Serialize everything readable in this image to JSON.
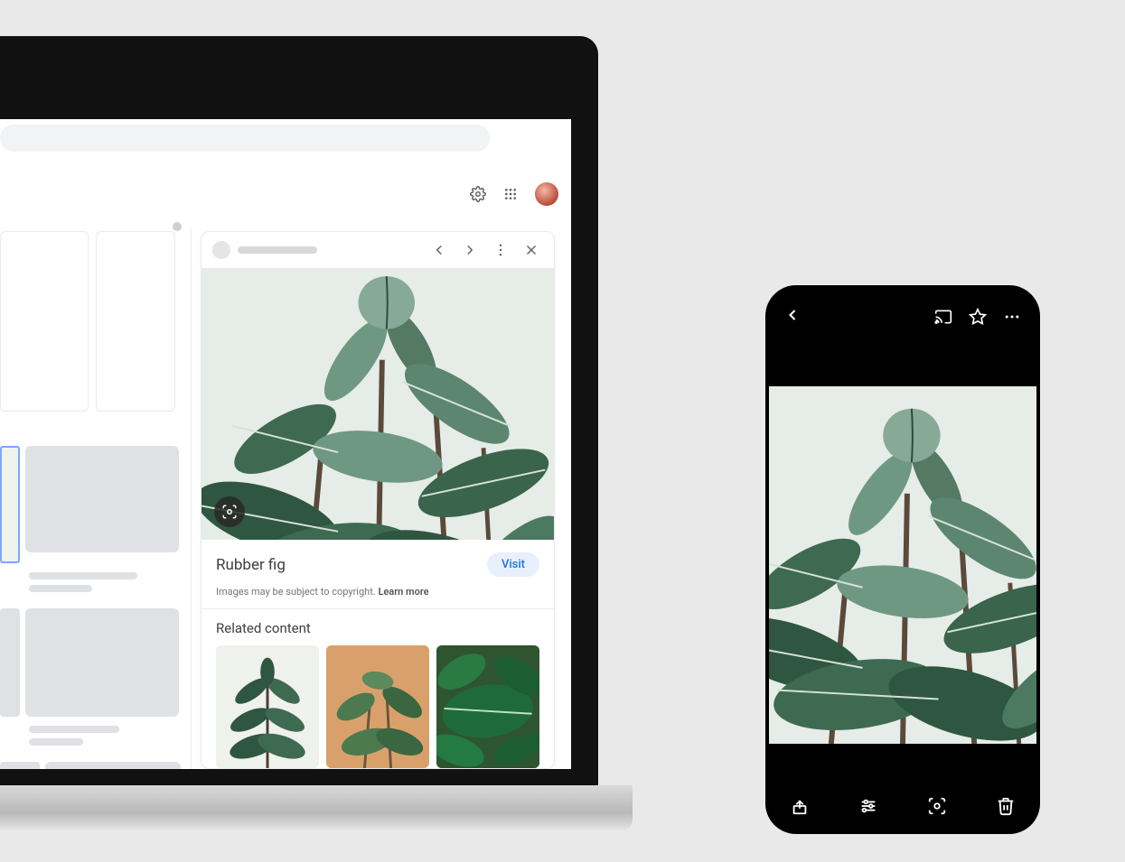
{
  "laptop": {
    "header": {
      "icons": {
        "settings": "settings",
        "apps": "apps",
        "avatar": "profile"
      }
    },
    "panel": {
      "nav": {
        "prev": "previous",
        "next": "next",
        "more": "more",
        "close": "close"
      },
      "lens": "lens",
      "title": "Rubber fig",
      "visit_label": "Visit",
      "copyright_text": "Images may be subject to copyright. ",
      "learn_more_label": "Learn more",
      "related_heading": "Related content"
    }
  },
  "phone": {
    "top": {
      "back": "back",
      "cast": "cast",
      "star": "star",
      "more": "more"
    },
    "bottom": {
      "share": "share",
      "edit": "edit",
      "lens": "lens",
      "delete": "delete"
    }
  }
}
